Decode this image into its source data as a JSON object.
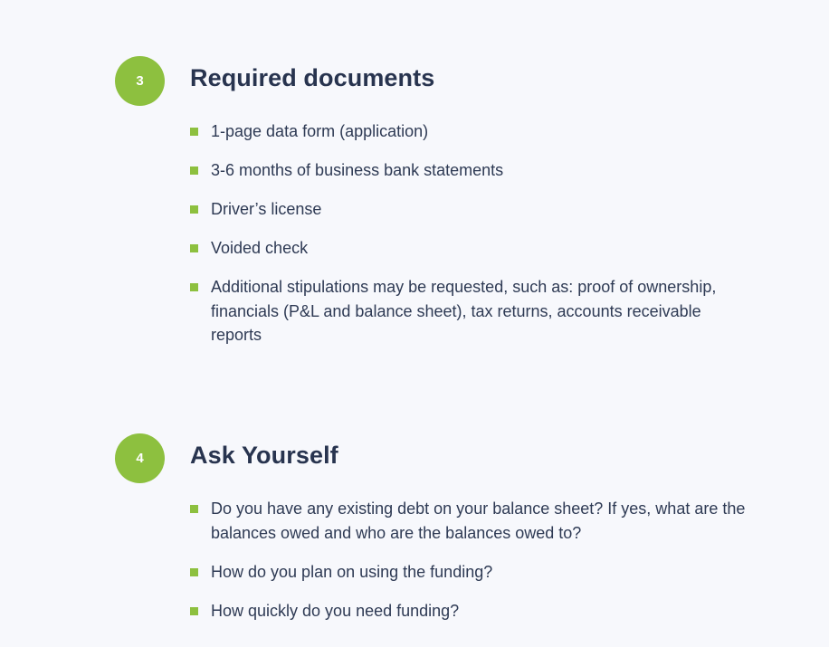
{
  "sections": [
    {
      "step": "3",
      "title": "Required documents",
      "items": [
        "1-page data form (application)",
        "3-6 months of business bank statements",
        "Driver’s license",
        "Voided check",
        "Additional stipulations may be requested, such as: proof of ownership, financials (P&L and balance sheet), tax returns, accounts receivable reports"
      ]
    },
    {
      "step": "4",
      "title": "Ask Yourself",
      "items": [
        "Do you have any existing debt on your balance sheet? If yes, what are the balances owed and who are the balances owed to?",
        "How do you plan on using the funding?",
        "How quickly do you need funding?"
      ]
    }
  ],
  "colors": {
    "accent": "#8dc03f",
    "heading": "#28344f",
    "text": "#2e3a54",
    "background": "#f7f8fc"
  }
}
